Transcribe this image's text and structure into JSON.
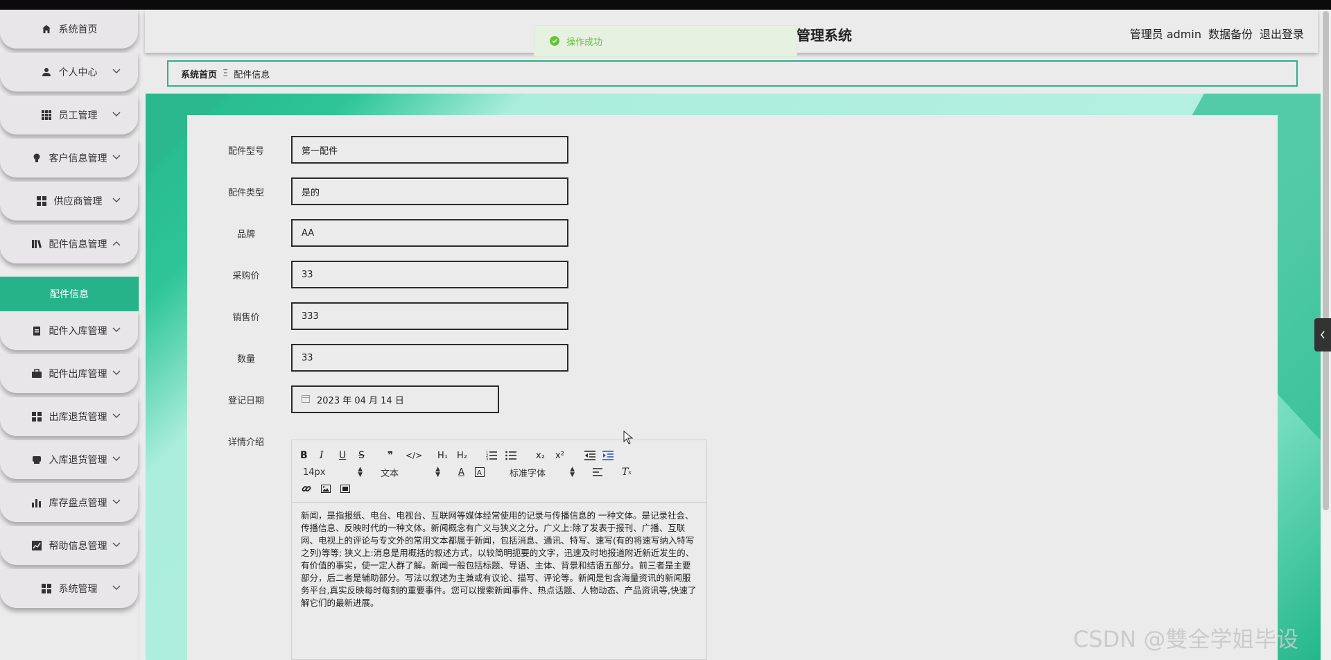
{
  "sidebar": {
    "items": [
      {
        "label": "系统首页",
        "icon": "home-icon",
        "has_chevron": false
      },
      {
        "label": "个人中心",
        "icon": "user-icon",
        "has_chevron": true
      },
      {
        "label": "员工管理",
        "icon": "grid-icon",
        "has_chevron": true
      },
      {
        "label": "客户信息管理",
        "icon": "bulb-icon",
        "has_chevron": true
      },
      {
        "label": "供应商管理",
        "icon": "apps-icon",
        "has_chevron": true
      },
      {
        "label": "配件信息管理",
        "icon": "book-icon",
        "has_chevron": true,
        "expanded": true
      },
      {
        "label": "配件入库管理",
        "icon": "clipboard-icon",
        "has_chevron": true
      },
      {
        "label": "配件出库管理",
        "icon": "briefcase-icon",
        "has_chevron": true
      },
      {
        "label": "出库退货管理",
        "icon": "apps-icon",
        "has_chevron": true
      },
      {
        "label": "入库退货管理",
        "icon": "printer-icon",
        "has_chevron": true
      },
      {
        "label": "库存盘点管理",
        "icon": "bar-chart-icon",
        "has_chevron": true
      },
      {
        "label": "帮助信息管理",
        "icon": "line-chart-icon",
        "has_chevron": true
      },
      {
        "label": "系统管理",
        "icon": "apps-icon",
        "has_chevron": true
      }
    ],
    "active_submenu": "配件信息"
  },
  "header": {
    "title": "管理系统",
    "user": "管理员 admin",
    "backup": "数据备份",
    "logout": "退出登录"
  },
  "toast": {
    "message": "操作成功",
    "color": "#67c23a"
  },
  "breadcrumb": {
    "home": "系统首页",
    "separator": "Ξ",
    "current": "配件信息"
  },
  "form": {
    "fields": [
      {
        "label": "配件型号",
        "value": "第一配件"
      },
      {
        "label": "配件类型",
        "value": "是的"
      },
      {
        "label": "品牌",
        "value": "AA"
      },
      {
        "label": "采购价",
        "value": "33"
      },
      {
        "label": "销售价",
        "value": "333"
      },
      {
        "label": "数量",
        "value": "33"
      }
    ],
    "date": {
      "label": "登记日期",
      "value": "2023 年 04 月 14 日"
    },
    "details": {
      "label": "详情介绍",
      "font_size": "14px",
      "text_type": "文本",
      "font_family": "标准字体",
      "content": "新闻，是指报纸、电台、电视台、互联网等媒体经常使用的记录与传播信息的 一种文体。是记录社会、传播信息、反映时代的一种文体。新闻概念有广义与狭义之分。广义上:除了发表于报刊、广播、互联网、电视上的评论与专文外的常用文本都属于新闻，包括消息、通讯、特写、速写(有的将速写纳入特写之列)等等; 狭义上:消息是用概括的叙述方式，以较简明扼要的文字，迅速及时地报道附近新近发生的、有价值的事实，使一定人群了解。新闻一般包括标题、导语、主体、背景和结语五部分。前三者是主要部分，后二者是辅助部分。写法以叙述为主兼或有议论、描写、评论等。新闻是包含海量资讯的新闻服务平台,真实反映每时每刻的重要事件。您可以搜索新闻事件、热点话题、人物动态、产品资讯等,快速了解它们的最新进展。"
    }
  },
  "watermark": "CSDN @雙全学姐毕设",
  "colors": {
    "accent": "#27b38a",
    "toast_bg": "#e7f1e1"
  }
}
